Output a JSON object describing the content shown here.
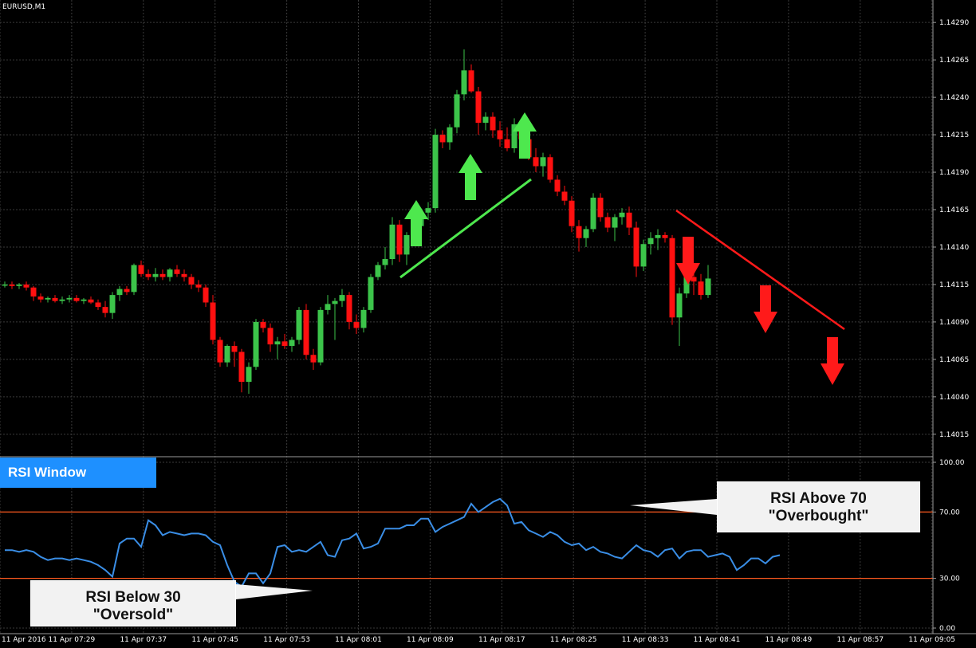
{
  "symbol_label": "EURUSD,M1",
  "rsi_panel": {
    "title": "RSI Window",
    "levels": {
      "upper": 70,
      "lower": 30
    },
    "overbought_callout": {
      "line1": "RSI Above 70",
      "line2": "\"Overbought\""
    },
    "oversold_callout": {
      "line1": "RSI Below 30",
      "line2": "\"Oversold\""
    }
  },
  "colors": {
    "background": "#000000",
    "grid": "#3a3a3a",
    "bull_candle": "#3cc44a",
    "bear_candle": "#ff1010",
    "rsi_line": "#3a8ee6",
    "level_line": "#ff5a1f",
    "trend_up": "#4ee84e",
    "trend_down": "#ff1a1a",
    "axis_text": "#ffffff"
  },
  "chart_data": [
    {
      "type": "candlestick",
      "title": "EURUSD,M1",
      "ylim": [
        1.14,
        1.14305
      ],
      "y_ticks": [
        "1.14290",
        "1.14265",
        "1.14240",
        "1.14215",
        "1.14190",
        "1.14165",
        "1.14140",
        "1.14115",
        "1.14090",
        "1.14065",
        "1.14040",
        "1.14015"
      ],
      "x_tick_labels": [
        "11 Apr 2016",
        "11 Apr 07:29",
        "11 Apr 07:37",
        "11 Apr 07:45",
        "11 Apr 07:53",
        "11 Apr 08:01",
        "11 Apr 08:09",
        "11 Apr 08:17",
        "11 Apr 08:25",
        "11 Apr 08:33",
        "11 Apr 08:41",
        "11 Apr 08:49",
        "11 Apr 08:57",
        "11 Apr 09:05"
      ],
      "candles": [
        [
          1.14115,
          1.14117,
          1.14113,
          1.14115
        ],
        [
          1.14115,
          1.14117,
          1.14112,
          1.14114
        ],
        [
          1.14114,
          1.14116,
          1.14112,
          1.14115
        ],
        [
          1.14115,
          1.14117,
          1.14111,
          1.14113
        ],
        [
          1.14113,
          1.14114,
          1.14104,
          1.14107
        ],
        [
          1.14107,
          1.14109,
          1.14103,
          1.14105
        ],
        [
          1.14105,
          1.14107,
          1.14103,
          1.14106
        ],
        [
          1.14106,
          1.14108,
          1.14103,
          1.14104
        ],
        [
          1.14104,
          1.14107,
          1.14102,
          1.14105
        ],
        [
          1.14105,
          1.14108,
          1.14103,
          1.14106
        ],
        [
          1.14106,
          1.14108,
          1.14103,
          1.14104
        ],
        [
          1.14104,
          1.14106,
          1.14102,
          1.14105
        ],
        [
          1.14105,
          1.14107,
          1.14102,
          1.14103
        ],
        [
          1.14103,
          1.14105,
          1.14098,
          1.141
        ],
        [
          1.141,
          1.14104,
          1.14093,
          1.14096
        ],
        [
          1.14096,
          1.1411,
          1.14092,
          1.14108
        ],
        [
          1.14108,
          1.14114,
          1.14104,
          1.14112
        ],
        [
          1.14112,
          1.14114,
          1.14108,
          1.1411
        ],
        [
          1.1411,
          1.14129,
          1.14108,
          1.14128
        ],
        [
          1.14128,
          1.14131,
          1.1412,
          1.14122
        ],
        [
          1.14122,
          1.14125,
          1.14118,
          1.1412
        ],
        [
          1.1412,
          1.14126,
          1.14117,
          1.14122
        ],
        [
          1.14122,
          1.14125,
          1.14118,
          1.1412
        ],
        [
          1.1412,
          1.14126,
          1.14117,
          1.14125
        ],
        [
          1.14125,
          1.14128,
          1.1412,
          1.14122
        ],
        [
          1.14122,
          1.14125,
          1.14117,
          1.1412
        ],
        [
          1.1412,
          1.14122,
          1.14112,
          1.14115
        ],
        [
          1.14115,
          1.14118,
          1.1411,
          1.14113
        ],
        [
          1.14113,
          1.14115,
          1.141,
          1.14103
        ],
        [
          1.14103,
          1.14108,
          1.14075,
          1.14078
        ],
        [
          1.14078,
          1.1408,
          1.1406,
          1.14063
        ],
        [
          1.14063,
          1.14075,
          1.1406,
          1.14074
        ],
        [
          1.14074,
          1.14077,
          1.1406,
          1.1407
        ],
        [
          1.1407,
          1.14072,
          1.14043,
          1.1405
        ],
        [
          1.1405,
          1.14063,
          1.14042,
          1.1406
        ],
        [
          1.1406,
          1.14092,
          1.14058,
          1.1409
        ],
        [
          1.1409,
          1.14092,
          1.14083,
          1.14086
        ],
        [
          1.14086,
          1.14089,
          1.1407,
          1.14075
        ],
        [
          1.14075,
          1.1408,
          1.14065,
          1.14077
        ],
        [
          1.14077,
          1.14082,
          1.14072,
          1.14074
        ],
        [
          1.14074,
          1.1408,
          1.1407,
          1.14078
        ],
        [
          1.14078,
          1.141,
          1.14075,
          1.14098
        ],
        [
          1.14098,
          1.14102,
          1.14065,
          1.14068
        ],
        [
          1.14068,
          1.14072,
          1.14058,
          1.14063
        ],
        [
          1.14063,
          1.141,
          1.14061,
          1.14098
        ],
        [
          1.14098,
          1.14108,
          1.14095,
          1.14102
        ],
        [
          1.14102,
          1.14106,
          1.14078,
          1.14104
        ],
        [
          1.14104,
          1.14112,
          1.141,
          1.14108
        ],
        [
          1.14108,
          1.1411,
          1.14085,
          1.1409
        ],
        [
          1.1409,
          1.14095,
          1.14082,
          1.14086
        ],
        [
          1.14086,
          1.141,
          1.14083,
          1.14098
        ],
        [
          1.14098,
          1.14122,
          1.14096,
          1.1412
        ],
        [
          1.1412,
          1.1413,
          1.14118,
          1.14128
        ],
        [
          1.14128,
          1.1414,
          1.14125,
          1.14132
        ],
        [
          1.14132,
          1.1416,
          1.14128,
          1.14155
        ],
        [
          1.14155,
          1.14158,
          1.1413,
          1.14135
        ],
        [
          1.14135,
          1.1415,
          1.14128,
          1.14148
        ],
        [
          1.14148,
          1.14158,
          1.14144,
          1.14154
        ],
        [
          1.14154,
          1.14166,
          1.1415,
          1.14163
        ],
        [
          1.14163,
          1.1417,
          1.14158,
          1.14166
        ],
        [
          1.14166,
          1.14219,
          1.14163,
          1.14215
        ],
        [
          1.14215,
          1.14218,
          1.14206,
          1.1421
        ],
        [
          1.1421,
          1.14222,
          1.14205,
          1.1422
        ],
        [
          1.1422,
          1.14245,
          1.14216,
          1.14242
        ],
        [
          1.14242,
          1.14272,
          1.14238,
          1.14258
        ],
        [
          1.14258,
          1.14262,
          1.14243,
          1.14244
        ],
        [
          1.14244,
          1.14247,
          1.14215,
          1.14223
        ],
        [
          1.14223,
          1.1423,
          1.14218,
          1.14227
        ],
        [
          1.14227,
          1.1423,
          1.14213,
          1.14218
        ],
        [
          1.14218,
          1.14224,
          1.14207,
          1.14212
        ],
        [
          1.14212,
          1.1422,
          1.14204,
          1.14206
        ],
        [
          1.14206,
          1.14226,
          1.14203,
          1.14222
        ],
        [
          1.14222,
          1.14226,
          1.1421,
          1.14212
        ],
        [
          1.14212,
          1.14214,
          1.14198,
          1.142
        ],
        [
          1.142,
          1.14206,
          1.1419,
          1.14194
        ],
        [
          1.14194,
          1.14203,
          1.14187,
          1.142
        ],
        [
          1.142,
          1.14202,
          1.14183,
          1.14185
        ],
        [
          1.14185,
          1.14188,
          1.14174,
          1.14177
        ],
        [
          1.14177,
          1.14181,
          1.14168,
          1.14171
        ],
        [
          1.14171,
          1.14174,
          1.1415,
          1.14154
        ],
        [
          1.14154,
          1.14158,
          1.14137,
          1.14146
        ],
        [
          1.14146,
          1.14154,
          1.1414,
          1.14152
        ],
        [
          1.14152,
          1.14176,
          1.1415,
          1.14173
        ],
        [
          1.14173,
          1.14176,
          1.14157,
          1.1416
        ],
        [
          1.1416,
          1.14163,
          1.1415,
          1.14153
        ],
        [
          1.14153,
          1.14162,
          1.14144,
          1.1416
        ],
        [
          1.1416,
          1.14166,
          1.14155,
          1.14163
        ],
        [
          1.14163,
          1.14167,
          1.14148,
          1.14153
        ],
        [
          1.14153,
          1.14157,
          1.1412,
          1.14127
        ],
        [
          1.14127,
          1.14145,
          1.14124,
          1.14142
        ],
        [
          1.14142,
          1.1415,
          1.14135,
          1.14146
        ],
        [
          1.14146,
          1.14152,
          1.14138,
          1.14148
        ],
        [
          1.14148,
          1.1415,
          1.14143,
          1.14146
        ],
        [
          1.14146,
          1.14148,
          1.14088,
          1.14093
        ],
        [
          1.14093,
          1.14113,
          1.14074,
          1.14109
        ],
        [
          1.14109,
          1.14122,
          1.14106,
          1.1412
        ],
        [
          1.1412,
          1.14125,
          1.14108,
          1.14117
        ],
        [
          1.14117,
          1.14122,
          1.14105,
          1.14108
        ],
        [
          1.14108,
          1.14128,
          1.14106,
          1.14119
        ]
      ],
      "annotations": {
        "uptrend_arrows": 3,
        "downtrend_arrows": 3
      }
    },
    {
      "type": "line",
      "title": "RSI Window",
      "ylim": [
        0,
        100
      ],
      "y_ticks": [
        "100.00",
        "70.00",
        "30.00",
        "0.00"
      ],
      "levels": [
        70,
        30
      ],
      "series": [
        {
          "values": [
            47,
            47,
            46,
            47,
            46,
            43,
            41,
            42,
            42,
            41,
            42,
            41,
            40,
            38,
            35,
            31,
            51,
            54,
            54,
            49,
            65,
            62,
            56,
            58,
            57,
            56,
            57,
            57,
            56,
            52,
            50,
            38,
            28,
            25,
            33,
            33,
            27,
            33,
            49,
            50,
            46,
            47,
            46,
            49,
            52,
            44,
            43,
            53,
            54,
            57,
            48,
            49,
            51,
            60,
            60,
            60,
            62,
            62,
            66,
            66,
            58,
            61,
            63,
            65,
            67,
            75,
            70,
            73,
            76,
            78,
            74,
            63,
            64,
            59,
            57,
            55,
            58,
            56,
            52,
            50,
            51,
            47,
            49,
            46,
            45,
            43,
            42,
            46,
            50,
            47,
            46,
            43,
            47,
            48,
            42,
            46,
            47,
            47,
            43,
            44,
            45,
            43,
            35,
            38,
            42,
            42,
            39,
            43,
            44
          ]
        }
      ]
    }
  ]
}
